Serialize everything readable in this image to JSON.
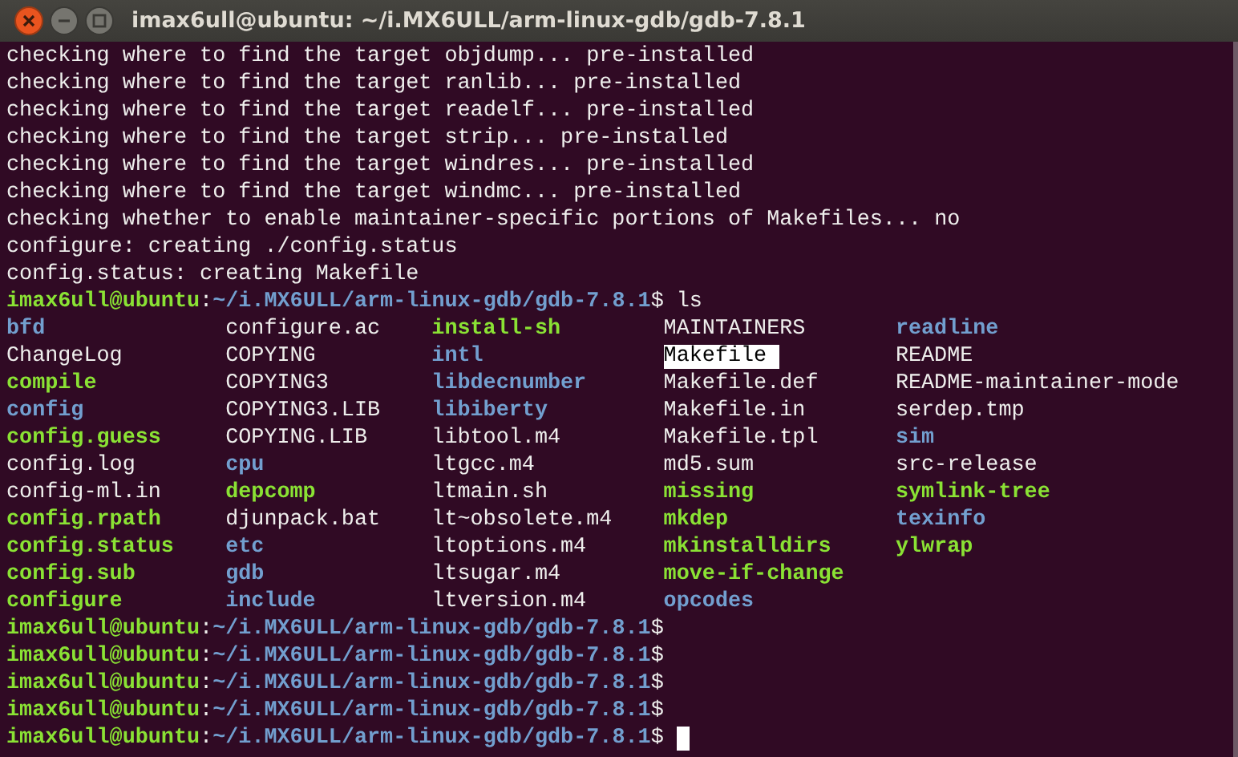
{
  "window": {
    "title": "imax6ull@ubuntu: ~/i.MX6ULL/arm-linux-gdb/gdb-7.8.1"
  },
  "lines": [
    {
      "kind": "output",
      "text": "checking where to find the target objdump... pre-installed"
    },
    {
      "kind": "output",
      "text": "checking where to find the target ranlib... pre-installed"
    },
    {
      "kind": "output",
      "text": "checking where to find the target readelf... pre-installed"
    },
    {
      "kind": "output",
      "text": "checking where to find the target strip... pre-installed"
    },
    {
      "kind": "output",
      "text": "checking where to find the target windres... pre-installed"
    },
    {
      "kind": "output",
      "text": "checking where to find the target windmc... pre-installed"
    },
    {
      "kind": "output",
      "text": "checking whether to enable maintainer-specific portions of Makefiles... no"
    },
    {
      "kind": "output",
      "text": "configure: creating ./config.status"
    },
    {
      "kind": "output",
      "text": "config.status: creating Makefile"
    },
    {
      "kind": "prompt",
      "user": "imax6ull@ubuntu",
      "separator": ":",
      "path": "~/i.MX6ULL/arm-linux-gdb/gdb-7.8.1",
      "symbol": "$",
      "command": "ls",
      "cursor": false
    },
    {
      "kind": "listing",
      "entries": [
        {
          "name": "bfd",
          "kind": "dir",
          "selected": false
        },
        {
          "name": "ChangeLog",
          "kind": "file",
          "selected": false
        },
        {
          "name": "compile",
          "kind": "exec",
          "selected": false
        },
        {
          "name": "config",
          "kind": "dir",
          "selected": false
        },
        {
          "name": "config.guess",
          "kind": "exec",
          "selected": false
        },
        {
          "name": "config.log",
          "kind": "file",
          "selected": false
        },
        {
          "name": "config-ml.in",
          "kind": "file",
          "selected": false
        },
        {
          "name": "config.rpath",
          "kind": "exec",
          "selected": false
        },
        {
          "name": "config.status",
          "kind": "exec",
          "selected": false
        },
        {
          "name": "config.sub",
          "kind": "exec",
          "selected": false
        },
        {
          "name": "configure",
          "kind": "exec",
          "selected": false
        },
        {
          "name": "configure.ac",
          "kind": "file",
          "selected": false
        },
        {
          "name": "COPYING",
          "kind": "file",
          "selected": false
        },
        {
          "name": "COPYING3",
          "kind": "file",
          "selected": false
        },
        {
          "name": "COPYING3.LIB",
          "kind": "file",
          "selected": false
        },
        {
          "name": "COPYING.LIB",
          "kind": "file",
          "selected": false
        },
        {
          "name": "cpu",
          "kind": "dir",
          "selected": false
        },
        {
          "name": "depcomp",
          "kind": "exec",
          "selected": false
        },
        {
          "name": "djunpack.bat",
          "kind": "file",
          "selected": false
        },
        {
          "name": "etc",
          "kind": "dir",
          "selected": false
        },
        {
          "name": "gdb",
          "kind": "dir",
          "selected": false
        },
        {
          "name": "include",
          "kind": "dir",
          "selected": false
        },
        {
          "name": "install-sh",
          "kind": "exec",
          "selected": false
        },
        {
          "name": "intl",
          "kind": "dir",
          "selected": false
        },
        {
          "name": "libdecnumber",
          "kind": "dir",
          "selected": false
        },
        {
          "name": "libiberty",
          "kind": "dir",
          "selected": false
        },
        {
          "name": "libtool.m4",
          "kind": "file",
          "selected": false
        },
        {
          "name": "ltgcc.m4",
          "kind": "file",
          "selected": false
        },
        {
          "name": "ltmain.sh",
          "kind": "file",
          "selected": false
        },
        {
          "name": "lt~obsolete.m4",
          "kind": "file",
          "selected": false
        },
        {
          "name": "ltoptions.m4",
          "kind": "file",
          "selected": false
        },
        {
          "name": "ltsugar.m4",
          "kind": "file",
          "selected": false
        },
        {
          "name": "ltversion.m4",
          "kind": "file",
          "selected": false
        },
        {
          "name": "MAINTAINERS",
          "kind": "file",
          "selected": false
        },
        {
          "name": "Makefile",
          "kind": "file",
          "selected": true
        },
        {
          "name": "Makefile.def",
          "kind": "file",
          "selected": false
        },
        {
          "name": "Makefile.in",
          "kind": "file",
          "selected": false
        },
        {
          "name": "Makefile.tpl",
          "kind": "file",
          "selected": false
        },
        {
          "name": "md5.sum",
          "kind": "file",
          "selected": false
        },
        {
          "name": "missing",
          "kind": "exec",
          "selected": false
        },
        {
          "name": "mkdep",
          "kind": "exec",
          "selected": false
        },
        {
          "name": "mkinstalldirs",
          "kind": "exec",
          "selected": false
        },
        {
          "name": "move-if-change",
          "kind": "exec",
          "selected": false
        },
        {
          "name": "opcodes",
          "kind": "dir",
          "selected": false
        },
        {
          "name": "readline",
          "kind": "dir",
          "selected": false
        },
        {
          "name": "README",
          "kind": "file",
          "selected": false
        },
        {
          "name": "README-maintainer-mode",
          "kind": "file",
          "selected": false
        },
        {
          "name": "serdep.tmp",
          "kind": "file",
          "selected": false
        },
        {
          "name": "sim",
          "kind": "dir",
          "selected": false
        },
        {
          "name": "src-release",
          "kind": "file",
          "selected": false
        },
        {
          "name": "symlink-tree",
          "kind": "exec",
          "selected": false
        },
        {
          "name": "texinfo",
          "kind": "dir",
          "selected": false
        },
        {
          "name": "ylwrap",
          "kind": "exec",
          "selected": false
        }
      ]
    },
    {
      "kind": "prompt",
      "user": "imax6ull@ubuntu",
      "separator": ":",
      "path": "~/i.MX6ULL/arm-linux-gdb/gdb-7.8.1",
      "symbol": "$",
      "cursor": false
    },
    {
      "kind": "prompt",
      "user": "imax6ull@ubuntu",
      "separator": ":",
      "path": "~/i.MX6ULL/arm-linux-gdb/gdb-7.8.1",
      "symbol": "$",
      "cursor": false
    },
    {
      "kind": "prompt",
      "user": "imax6ull@ubuntu",
      "separator": ":",
      "path": "~/i.MX6ULL/arm-linux-gdb/gdb-7.8.1",
      "symbol": "$",
      "cursor": false
    },
    {
      "kind": "prompt",
      "user": "imax6ull@ubuntu",
      "separator": ":",
      "path": "~/i.MX6ULL/arm-linux-gdb/gdb-7.8.1",
      "symbol": "$",
      "cursor": false
    },
    {
      "kind": "prompt",
      "user": "imax6ull@ubuntu",
      "separator": ":",
      "path": "~/i.MX6ULL/arm-linux-gdb/gdb-7.8.1",
      "symbol": "$",
      "cursor": true
    }
  ]
}
